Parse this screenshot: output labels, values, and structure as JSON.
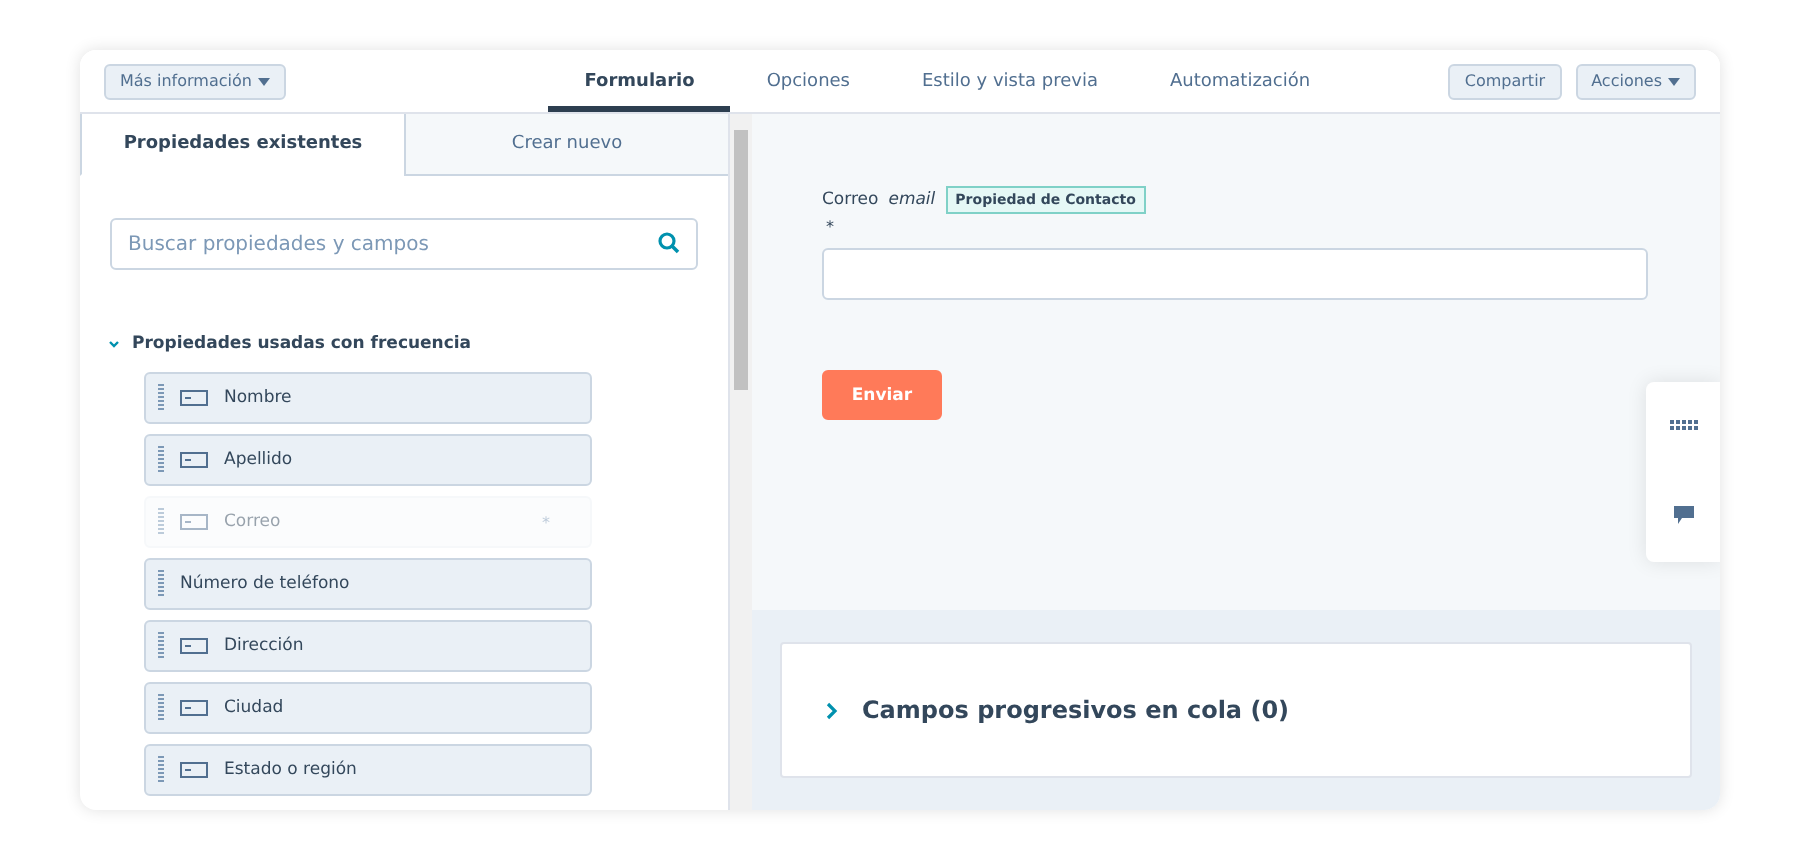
{
  "toolbar": {
    "more_button": "Más información",
    "tabs": [
      {
        "label": "Formulario",
        "selected": true
      },
      {
        "label": "Opciones",
        "selected": false
      },
      {
        "label": "Estilo y vista previa",
        "selected": false
      },
      {
        "label": "Automatización",
        "selected": false
      }
    ],
    "share_button": "Compartir",
    "actions_button": "Acciones"
  },
  "sidebar": {
    "tabs": [
      {
        "label": "Propiedades existentes",
        "selected": true
      },
      {
        "label": "Crear nuevo",
        "selected": false
      }
    ],
    "search": {
      "placeholder": "Buscar propiedades y campos"
    },
    "group": {
      "title": "Propiedades usadas con frecuencia",
      "expanded": true,
      "items": [
        {
          "label": "Nombre",
          "kind": "field",
          "disabled": false
        },
        {
          "label": "Apellido",
          "kind": "field",
          "disabled": false
        },
        {
          "label": "Correo",
          "kind": "field",
          "disabled": true,
          "marker": "*"
        },
        {
          "label": "Número de teléfono",
          "kind": "plain",
          "disabled": false
        },
        {
          "label": "Dirección",
          "kind": "field",
          "disabled": false
        },
        {
          "label": "Ciudad",
          "kind": "field",
          "disabled": false
        },
        {
          "label": "Estado o región",
          "kind": "field",
          "disabled": false
        }
      ]
    }
  },
  "form": {
    "field": {
      "label": "Correo",
      "type": "email",
      "badge": "Propiedad de Contacto",
      "required": "*"
    },
    "submit": "Enviar"
  },
  "progressive": {
    "title": "Campos progresivos en cola (0)",
    "expanded": false
  }
}
